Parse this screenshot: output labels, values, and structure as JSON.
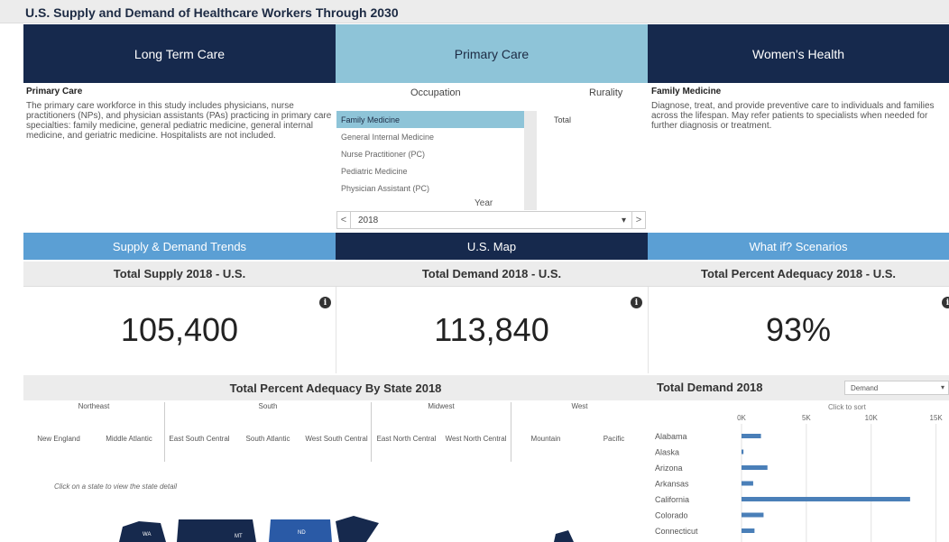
{
  "title": "U.S. Supply and Demand of Healthcare Workers Through 2030",
  "top_tabs": [
    "Long Term Care",
    "Primary Care",
    "Women's Health"
  ],
  "left_info": {
    "heading": "Primary Care",
    "body": "The primary care workforce in this study includes physicians, nurse practitioners (NPs), and physician assistants (PAs) practicing in primary care specialties: family medicine, general pediatric medicine, general internal medicine, and geriatric medicine. Hospitalists are not included."
  },
  "filters": {
    "occupation_label": "Occupation",
    "rurality_label": "Rurality",
    "occupations": [
      "Family Medicine",
      "General Internal Medicine",
      "Nurse Practitioner (PC)",
      "Pediatric Medicine",
      "Physician Assistant (PC)"
    ],
    "selected_occupation": "Family Medicine",
    "rurality_options": [
      "Total"
    ],
    "year_label": "Year",
    "year_value": "2018",
    "prev_arrow": "<",
    "next_arrow": ">"
  },
  "right_info": {
    "heading": "Family Medicine",
    "body": "Diagnose, treat, and provide preventive care to individuals and families across the lifespan. May refer patients to specialists when needed for further diagnosis or treatment."
  },
  "nav_tabs": [
    "Supply & Demand Trends",
    "U.S. Map",
    "What if? Scenarios"
  ],
  "metrics": [
    {
      "label": "Total Supply 2018 - U.S.",
      "value": "105,400"
    },
    {
      "label": "Total Demand 2018 - U.S.",
      "value": "113,840"
    },
    {
      "label": "Total Percent Adequacy 2018 - U.S.",
      "value": "93%"
    }
  ],
  "map_panel": {
    "title": "Total Percent Adequacy By State 2018",
    "regions": [
      "Northeast",
      "South",
      "Midwest",
      "West"
    ],
    "divisions": [
      "New England",
      "Middle Atlantic",
      "East South Central",
      "South Atlantic",
      "West South Central",
      "East North Central",
      "West North Central",
      "Mountain",
      "Pacific"
    ],
    "hint": "Click on a state to view the state detail",
    "state_labels": [
      "WA",
      "MT",
      "ND"
    ]
  },
  "bar_panel": {
    "title": "Total Demand 2018",
    "dropdown_value": "Demand",
    "sort_hint": "Click to sort"
  },
  "colors": {
    "navy": "#16294d",
    "light_blue": "#8ec4d8",
    "mid_blue": "#5b9fd4",
    "bar": "#4a7fb8"
  },
  "chart_data": {
    "type": "bar",
    "orientation": "horizontal",
    "title": "Total Demand 2018",
    "categories": [
      "Alabama",
      "Alaska",
      "Arizona",
      "Arkansas",
      "California",
      "Colorado",
      "Connecticut"
    ],
    "values": [
      1500,
      150,
      2000,
      900,
      13000,
      1700,
      1000
    ],
    "x_ticks": [
      "0K",
      "5K",
      "10K",
      "15K"
    ],
    "xlim": [
      0,
      16000
    ]
  }
}
